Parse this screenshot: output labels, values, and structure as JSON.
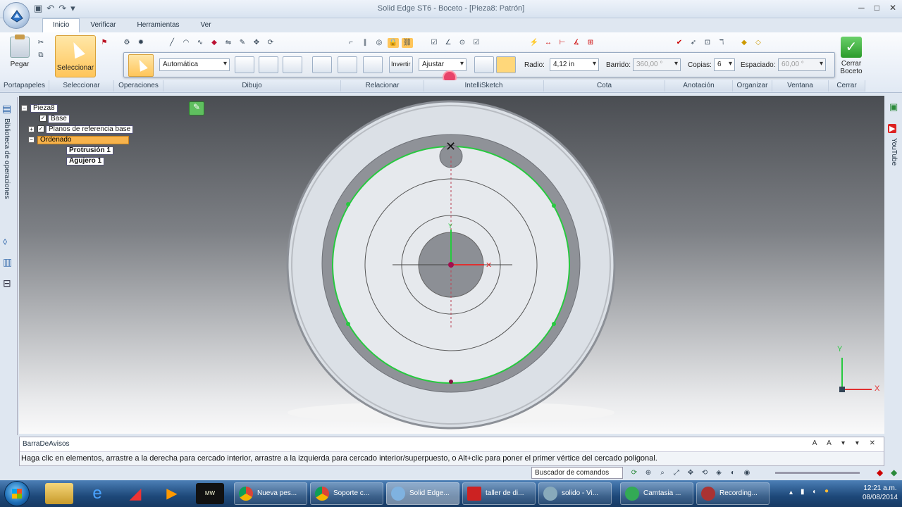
{
  "window": {
    "title": "Solid Edge ST6 - Boceto - [Pieza8: Patrón]"
  },
  "quick_access": {
    "icons": [
      "save-icon",
      "undo-icon",
      "redo-icon",
      "dropdown-icon"
    ]
  },
  "tabs": [
    {
      "label": "Inicio",
      "active": true
    },
    {
      "label": "Verificar"
    },
    {
      "label": "Herramientas"
    },
    {
      "label": "Ver"
    }
  ],
  "ribbon": {
    "paste_label": "Pegar",
    "select_label": "Seleccionar",
    "close_sketch_label_1": "Cerrar",
    "close_sketch_label_2": "Boceto",
    "groups": [
      "Portapapeles",
      "Seleccionar",
      "Operaciones",
      "Dibujo",
      "Relacionar",
      "IntelliSketch",
      "Cota",
      "Anotación",
      "Organizar",
      "Ventana",
      "Cerrar"
    ]
  },
  "command_bar": {
    "style_value": "Automática",
    "invert_label": "Invertir",
    "fit_value": "Ajustar",
    "radius_label": "Radio:",
    "radius_value": "4,12 in",
    "sweep_label": "Barrido:",
    "sweep_value": "360,00 °",
    "copies_label": "Copias:",
    "copies_value": "6",
    "spacing_label": "Espaciado:",
    "spacing_value": "60,00 °"
  },
  "side": {
    "left_panel": "Biblioteca de operaciones",
    "right_panel": "YouTube"
  },
  "tree": {
    "root": "Pieza8",
    "items": [
      "Base",
      "Planos de referencia base",
      "Ordenado",
      "Protrusión 1",
      "Agujero 1"
    ]
  },
  "triad": {
    "x": "X",
    "y": "Y"
  },
  "message_bar": {
    "title": "BarraDeAvisos",
    "text": "Haga clic en elementos, arrastre a la derecha para cercado interior, arrastre a la izquierda para cercado interior/superpuesto, o Alt+clic para poner el primer vértice del cercado poligonal."
  },
  "command_finder": "Buscador de comandos",
  "taskbar": {
    "tasks": [
      "Nueva pes...",
      "Soporte c...",
      "Solid Edge...",
      "taller de di...",
      "solido - Vi...",
      "Camtasia ...",
      "Recording..."
    ],
    "time": "12:21 a.m.",
    "date": "08/08/2014"
  },
  "colors": {
    "accent": "#ffc55a",
    "sketch_green": "#27c93f",
    "canvas_top": "#4a4d52"
  }
}
